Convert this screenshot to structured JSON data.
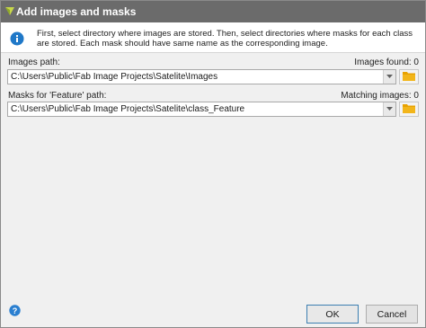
{
  "window": {
    "title": "Add images and masks"
  },
  "info": {
    "text": "First, select directory where images are stored. Then, select directories where masks for each class are stored. Each mask should have same name as the corresponding image.",
    "icon": "info-icon"
  },
  "images": {
    "label": "Images path:",
    "found_label": "Images found: 0",
    "path_value": "C:\\Users\\Public\\Fab Image Projects\\Satelite\\Images"
  },
  "masks": {
    "label": "Masks for 'Feature' path:",
    "matching_label": "Matching images: 0",
    "path_value": "C:\\Users\\Public\\Fab Image Projects\\Satelite\\class_Feature"
  },
  "footer": {
    "ok_label": "OK",
    "cancel_label": "Cancel",
    "help_icon": "help-icon"
  },
  "colors": {
    "titlebar": "#6b6b6b",
    "info_blue": "#1f78c8",
    "folder": "#e8a200",
    "help_blue": "#2a7fd0"
  }
}
